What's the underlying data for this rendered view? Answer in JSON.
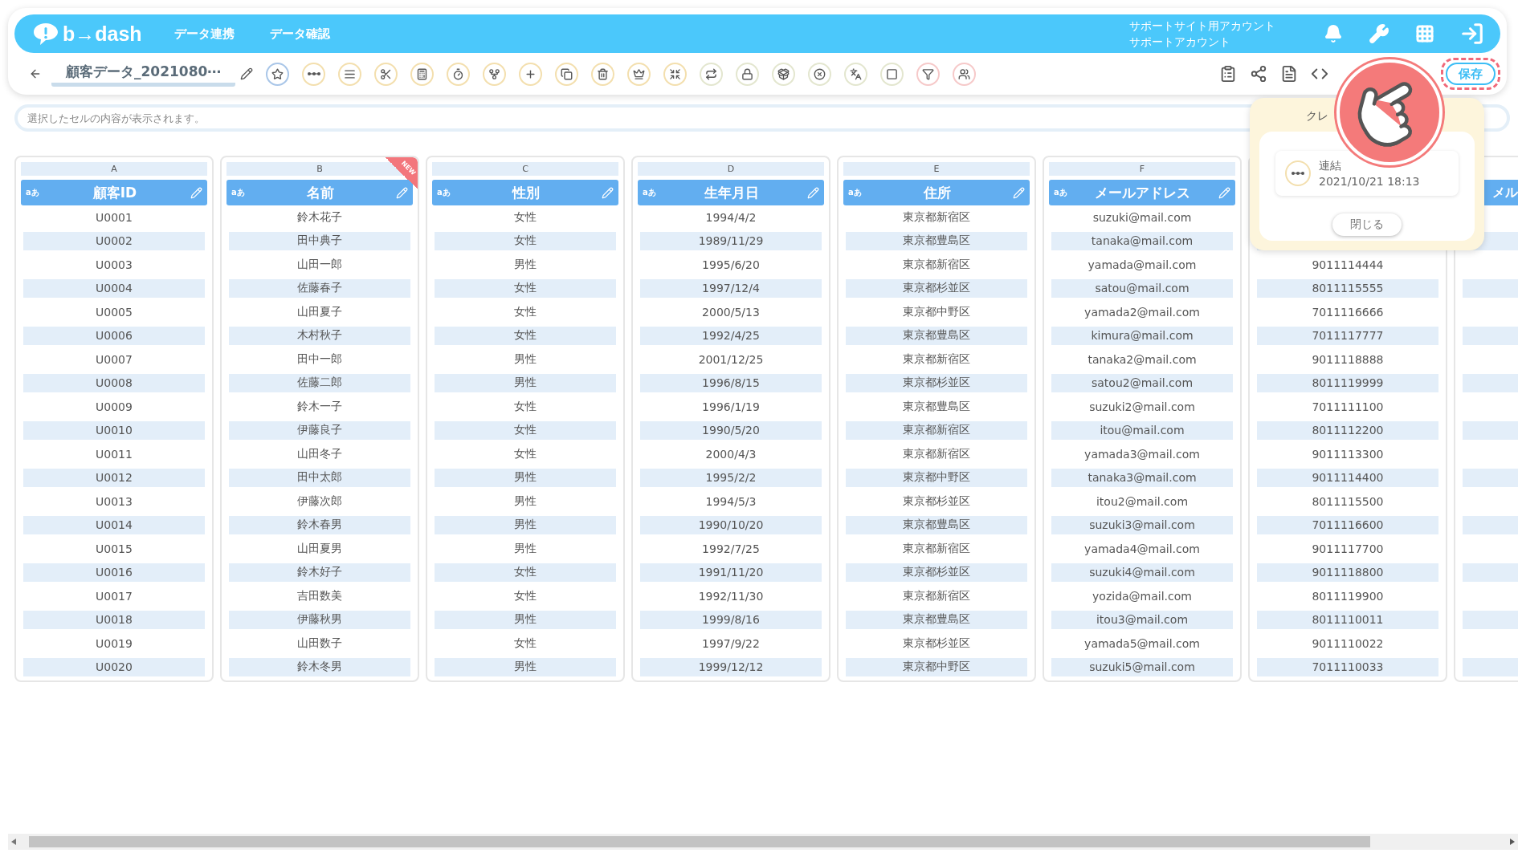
{
  "header": {
    "logo": "b→dash",
    "nav": [
      "データ連携",
      "データ確認"
    ],
    "account": [
      "サポートサイト用アカウント",
      "サポートアカウント"
    ]
  },
  "toolbar": {
    "title": "顧客データ_2021080⋯",
    "tools": [
      {
        "kind": "star",
        "color": "#a9c6e8"
      },
      {
        "kind": "join",
        "color": "#f3dfae"
      },
      {
        "kind": "text",
        "color": "#f3dfae"
      },
      {
        "kind": "split",
        "color": "#f3dfae"
      },
      {
        "kind": "calc",
        "color": "#f3dfae"
      },
      {
        "kind": "timer",
        "color": "#f3dfae"
      },
      {
        "kind": "branch",
        "color": "#f3dfae"
      },
      {
        "kind": "add",
        "color": "#f3dfae"
      },
      {
        "kind": "copy",
        "color": "#f3dfae"
      },
      {
        "kind": "trash",
        "color": "#f3dfae"
      },
      {
        "kind": "crown",
        "color": "#f3dfae"
      },
      {
        "kind": "shrink",
        "color": "#f3dfae"
      },
      {
        "kind": "repeat",
        "color": "#e3e6cf"
      },
      {
        "kind": "lock",
        "color": "#e3e6cf"
      },
      {
        "kind": "package",
        "color": "#e3e6cf"
      },
      {
        "kind": "cancel",
        "color": "#e3e6cf"
      },
      {
        "kind": "translate",
        "color": "#e3e6cf"
      },
      {
        "kind": "zero",
        "color": "#e3e6cf"
      },
      {
        "kind": "filter",
        "color": "#f6c9c9"
      },
      {
        "kind": "group",
        "color": "#f6c9c9"
      }
    ],
    "actions": [
      {
        "kind": "clipboard"
      },
      {
        "kind": "share"
      },
      {
        "kind": "file"
      },
      {
        "kind": "code"
      }
    ],
    "save_button": "保存"
  },
  "cell_field": {
    "placeholder": "選択したセルの内容が表示されます。"
  },
  "table": {
    "columns": [
      {
        "letter": "A",
        "type_label": "aあ",
        "label": "顧客ID",
        "cells": [
          "U0001",
          "U0002",
          "U0003",
          "U0004",
          "U0005",
          "U0006",
          "U0007",
          "U0008",
          "U0009",
          "U0010",
          "U0011",
          "U0012",
          "U0013",
          "U0014",
          "U0015",
          "U0016",
          "U0017",
          "U0018",
          "U0019",
          "U0020"
        ]
      },
      {
        "letter": "B",
        "type_label": "aあ",
        "label": "名前",
        "badge": "NEW",
        "cells": [
          "鈴木花子",
          "田中典子",
          "山田一郎",
          "佐藤春子",
          "山田夏子",
          "木村秋子",
          "田中一郎",
          "佐藤二郎",
          "鈴木一子",
          "伊藤良子",
          "山田冬子",
          "田中太郎",
          "伊藤次郎",
          "鈴木春男",
          "山田夏男",
          "鈴木好子",
          "吉田数美",
          "伊藤秋男",
          "山田数子",
          "鈴木冬男"
        ]
      },
      {
        "letter": "C",
        "type_label": "aあ",
        "label": "性別",
        "cells": [
          "女性",
          "女性",
          "男性",
          "女性",
          "女性",
          "女性",
          "男性",
          "男性",
          "女性",
          "女性",
          "女性",
          "男性",
          "男性",
          "男性",
          "男性",
          "女性",
          "女性",
          "男性",
          "女性",
          "男性"
        ]
      },
      {
        "letter": "D",
        "type_label": "aあ",
        "label": "生年月日",
        "cells": [
          "1994/4/2",
          "1989/11/29",
          "1995/6/20",
          "1997/12/4",
          "2000/5/13",
          "1992/4/25",
          "2001/12/25",
          "1996/8/15",
          "1996/1/19",
          "1990/5/20",
          "2000/4/3",
          "1995/2/2",
          "1994/5/3",
          "1990/10/20",
          "1992/7/25",
          "1991/11/20",
          "1992/11/30",
          "1999/8/16",
          "1997/9/22",
          "1999/12/12"
        ]
      },
      {
        "letter": "E",
        "type_label": "aあ",
        "label": "住所",
        "cells": [
          "東京都新宿区",
          "東京都豊島区",
          "東京都新宿区",
          "東京都杉並区",
          "東京都中野区",
          "東京都豊島区",
          "東京都新宿区",
          "東京都杉並区",
          "東京都豊島区",
          "東京都新宿区",
          "東京都新宿区",
          "東京都中野区",
          "東京都杉並区",
          "東京都豊島区",
          "東京都新宿区",
          "東京都杉並区",
          "東京都新宿区",
          "東京都豊島区",
          "東京都杉並区",
          "東京都中野区"
        ]
      },
      {
        "letter": "F",
        "type_label": "aあ",
        "label": "メールアドレス",
        "cells": [
          "suzuki@mail.com",
          "tanaka@mail.com",
          "yamada@mail.com",
          "satou@mail.com",
          "yamada2@mail.com",
          "kimura@mail.com",
          "tanaka2@mail.com",
          "satou2@mail.com",
          "suzuki2@mail.com",
          "itou@mail.com",
          "yamada3@mail.com",
          "tanaka3@mail.com",
          "itou2@mail.com",
          "suzuki3@mail.com",
          "yamada4@mail.com",
          "suzuki4@mail.com",
          "yozida@mail.com",
          "itou3@mail.com",
          "yamada5@mail.com",
          "suzuki5@mail.com"
        ]
      },
      {
        "cells": [
          null,
          null,
          "9011114444",
          "8011115555",
          "7011116666",
          "7011117777",
          "9011118888",
          "8011119999",
          "7011111100",
          "8011112200",
          "9011113300",
          "9011114400",
          "8011115500",
          "7011116600",
          "9011117700",
          "9011118800",
          "8011119900",
          "8011110011",
          "9011110022",
          "7011110033"
        ]
      },
      {
        "label": "メル"
      }
    ]
  },
  "popup": {
    "title": "クレ",
    "item": {
      "name": "連結",
      "time": "2021/10/21 18:13"
    },
    "close_button": "閉じる"
  }
}
